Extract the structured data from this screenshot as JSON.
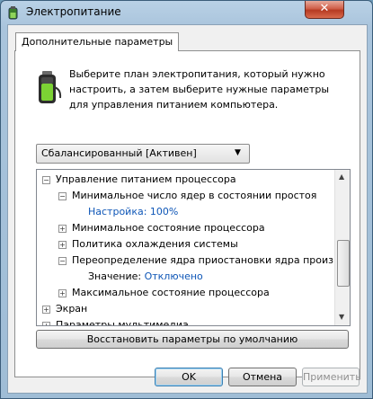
{
  "window": {
    "title": "Электропитание"
  },
  "tab": {
    "label": "Дополнительные параметры"
  },
  "description": "Выберите план электропитания, который нужно настроить, а затем выберите нужные параметры для управления питанием компьютера.",
  "plan_select": {
    "value": "Сбалансированный [Активен]"
  },
  "tree": {
    "items": [
      {
        "label": "Управление питанием процессора",
        "expander": "−"
      },
      {
        "label": "Минимальное число ядер в состоянии простоя",
        "expander": "−"
      },
      {
        "label": "Настройка: 100%"
      },
      {
        "label": "Минимальное состояние процессора",
        "expander": "+"
      },
      {
        "label": "Политика охлаждения системы",
        "expander": "+"
      },
      {
        "label": "Переопределение ядра приостановки ядра производ",
        "expander": "−"
      },
      {
        "value_label": "Значение:",
        "value": "Отключено"
      },
      {
        "label": "Максимальное состояние процессора",
        "expander": "+"
      },
      {
        "label": "Экран",
        "expander": "+"
      },
      {
        "label": "Параметры мультимедиа",
        "expander": "+"
      }
    ]
  },
  "restore_button": "Восстановить параметры по умолчанию",
  "buttons": {
    "ok": "OK",
    "cancel": "Отмена",
    "apply": "Применить"
  },
  "icons": {
    "app": "power-options-icon",
    "battery": "battery-plug-icon"
  }
}
